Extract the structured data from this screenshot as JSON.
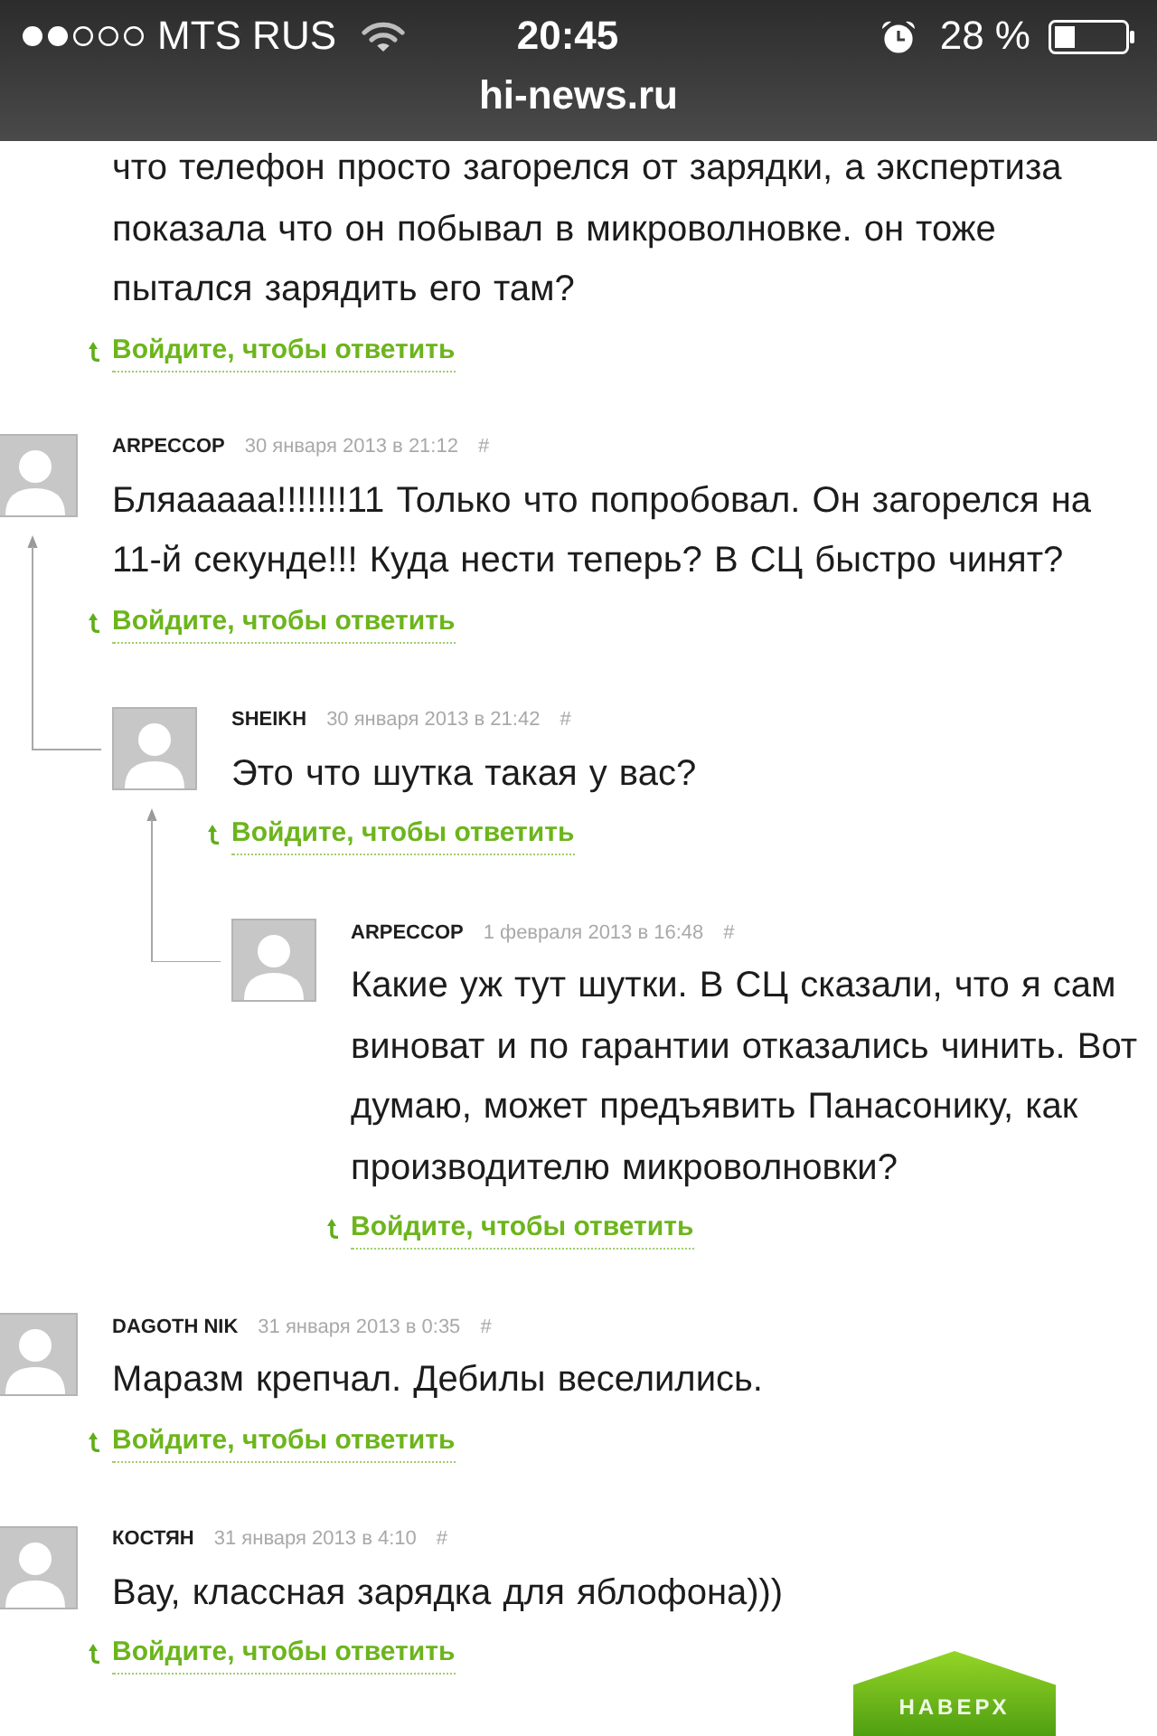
{
  "status_bar": {
    "carrier": "MTS RUS",
    "time": "20:45",
    "battery": "28 %"
  },
  "address_bar": {
    "url": "hi-news.ru"
  },
  "partial_comment": {
    "text": "что телефон просто загорелся от зарядки, а экспертиза показала что он побывал в микроволновке. он тоже пытался зарядить его там?",
    "reply_link": "Войдите, чтобы ответить"
  },
  "comments": [
    {
      "author": "ARPECCOP",
      "date": "30 января 2013 в 21:12",
      "anchor": "#",
      "text": "Бляааааа!!!!!!!11 Только что попробовал. Он загорелся на 11-й секунде!!! Куда нести теперь? В СЦ быстро чинят?",
      "reply_link": "Войдите, чтобы ответить",
      "children": [
        {
          "author": "SHEIKH",
          "date": "30 января 2013 в 21:42",
          "anchor": "#",
          "text": "Это что шутка такая у вас?",
          "reply_link": "Войдите, чтобы ответить",
          "children": [
            {
              "author": "ARPECCOP",
              "date": "1 февраля 2013 в 16:48",
              "anchor": "#",
              "text": "Какие уж тут шутки. В СЦ сказали, что я сам виноват и по гарантии отказались чинить. Вот думаю, может предъявить Панасонику, как производителю микроволновки?",
              "reply_link": "Войдите, чтобы ответить"
            }
          ]
        }
      ]
    },
    {
      "author": "DAGOTH NIK",
      "date": "31 января 2013 в 0:35",
      "anchor": "#",
      "text": "Маразм крепчал. Дебилы веселились.",
      "reply_link": "Войдите, чтобы ответить"
    },
    {
      "author": "КОСТЯН",
      "date": "31 января 2013 в 4:10",
      "anchor": "#",
      "text": "Вау, классная зарядка для яблофона)))",
      "reply_link": "Войдите, чтобы ответить"
    }
  ],
  "back_to_top": {
    "label": "НАВЕРХ"
  }
}
